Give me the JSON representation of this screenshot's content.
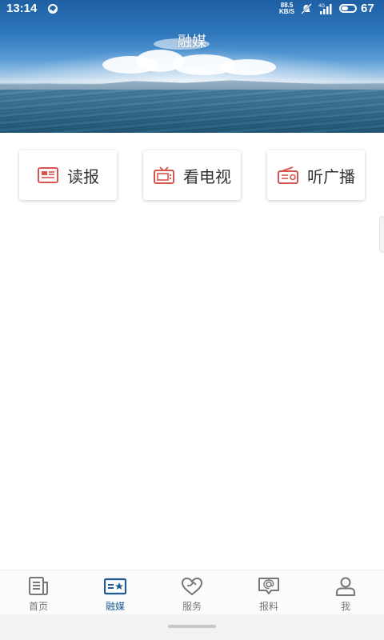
{
  "status_bar": {
    "time": "13:14",
    "net_speed_value": "88.5",
    "net_speed_unit": "KB/S",
    "network_type": "4G",
    "battery_level": "67"
  },
  "header": {
    "title": "融媒"
  },
  "entries": [
    {
      "label": "读报",
      "icon": "newspaper-icon"
    },
    {
      "label": "看电视",
      "icon": "tv-icon"
    },
    {
      "label": "听广播",
      "icon": "radio-icon"
    }
  ],
  "bottom_nav": {
    "items": [
      {
        "label": "首页",
        "icon": "home-news-icon",
        "active": false
      },
      {
        "label": "融媒",
        "icon": "media-card-icon",
        "active": true
      },
      {
        "label": "服务",
        "icon": "heart-service-icon",
        "active": false
      },
      {
        "label": "报料",
        "icon": "report-chat-icon",
        "active": false
      },
      {
        "label": "我",
        "icon": "user-icon",
        "active": false
      }
    ]
  },
  "colors": {
    "icon_red": "#d9534f",
    "nav_active": "#1f5b93",
    "nav_inactive": "#777777"
  }
}
